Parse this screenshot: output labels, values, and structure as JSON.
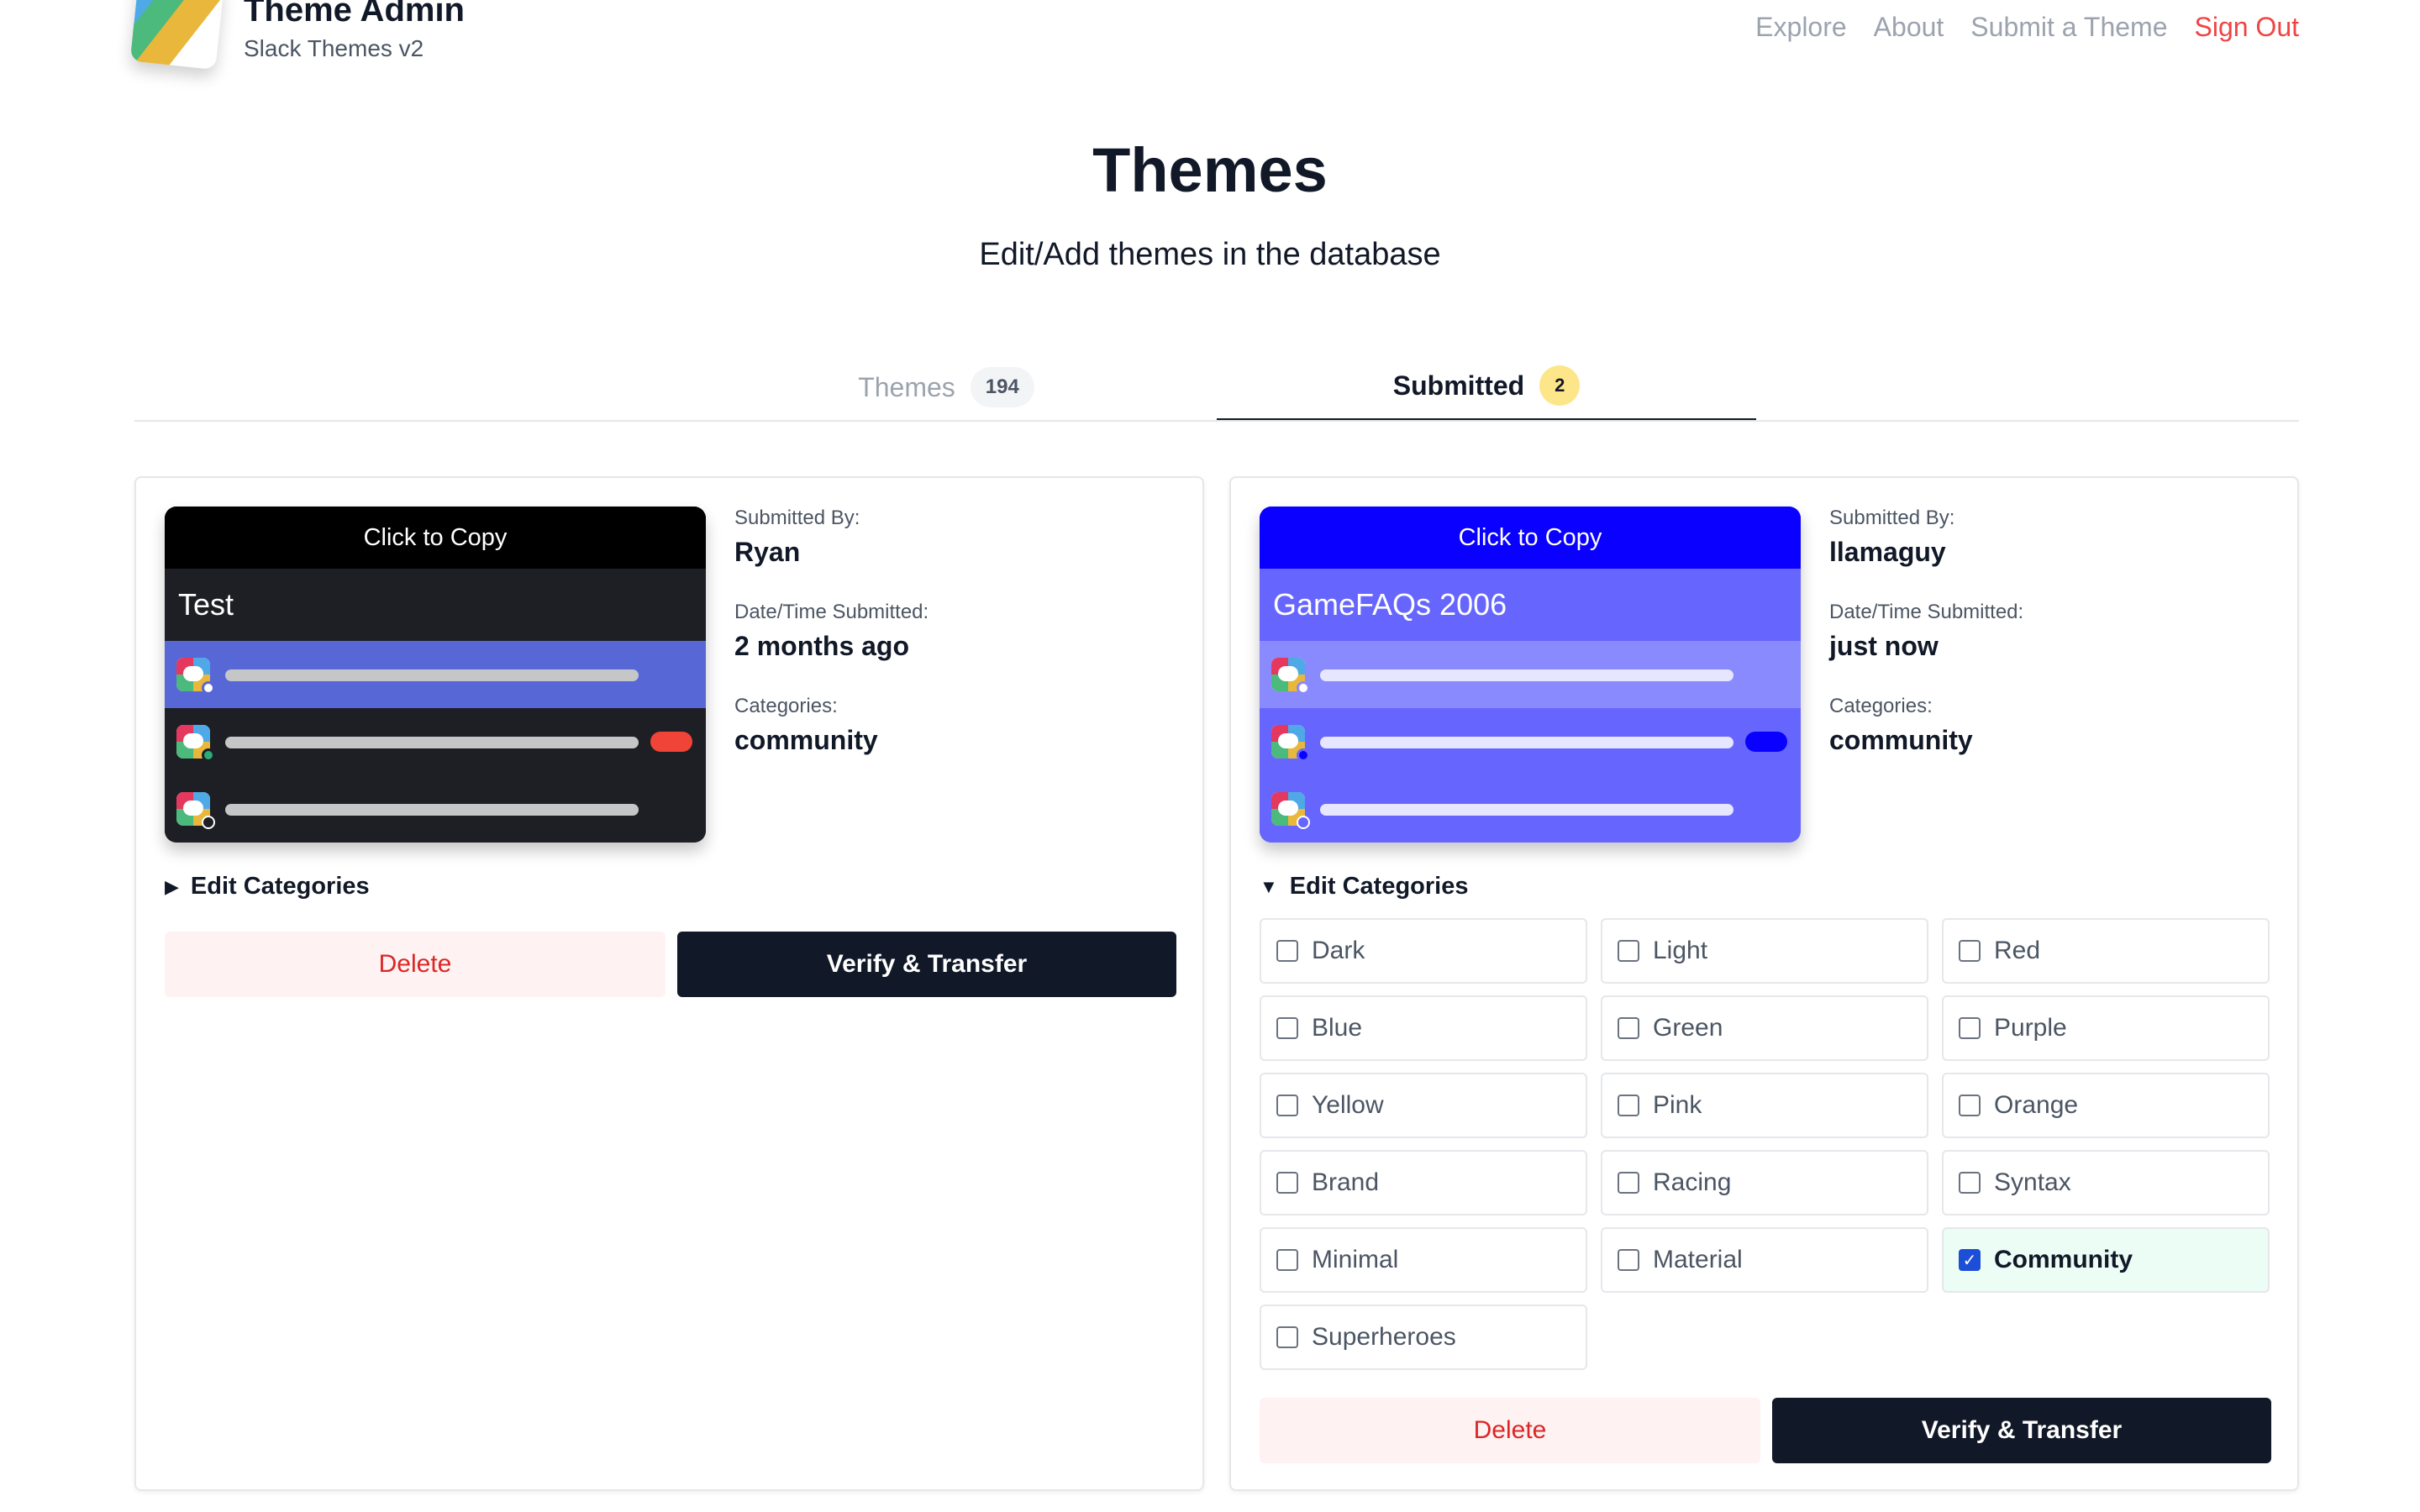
{
  "header": {
    "title": "Theme Admin",
    "subtitle": "Slack Themes v2",
    "nav": [
      "Explore",
      "About",
      "Submit a Theme"
    ],
    "sign_out": "Sign Out"
  },
  "hero": {
    "title": "Themes",
    "subtitle": "Edit/Add themes in the database"
  },
  "tabs": [
    {
      "label": "Themes",
      "count": "194",
      "active": false
    },
    {
      "label": "Submitted",
      "count": "2",
      "active": true
    }
  ],
  "labels": {
    "copy": "Click to Copy",
    "submitted_by": "Submitted By:",
    "date_time": "Date/Time Submitted:",
    "categories": "Categories:",
    "edit_categories": "Edit Categories",
    "delete": "Delete",
    "verify": "Verify & Transfer",
    "collapsed_marker": "▶",
    "expanded_marker": "▼"
  },
  "cards": [
    {
      "theme_name": "Test",
      "submitted_by": "Ryan",
      "submitted_at": "2 months ago",
      "categories": "community",
      "categories_expanded": false,
      "colors": {
        "copy_bar": "#000000",
        "sidebar": "#1e1f24",
        "active": "#5867d6",
        "bar": "#c5c6c8",
        "mention": "#f04438",
        "presence": "#2bac76"
      }
    },
    {
      "theme_name": "GameFAQs 2006",
      "submitted_by": "llamaguy",
      "submitted_at": "just now",
      "categories": "community",
      "categories_expanded": true,
      "colors": {
        "copy_bar": "#0a00ff",
        "sidebar": "#6666ff",
        "active": "#8a8aff",
        "bar": "#e6e6ff",
        "mention": "#0a00ff",
        "presence": "#0a00ff"
      },
      "category_options": [
        {
          "label": "Dark",
          "checked": false
        },
        {
          "label": "Light",
          "checked": false
        },
        {
          "label": "Red",
          "checked": false
        },
        {
          "label": "Blue",
          "checked": false
        },
        {
          "label": "Green",
          "checked": false
        },
        {
          "label": "Purple",
          "checked": false
        },
        {
          "label": "Yellow",
          "checked": false
        },
        {
          "label": "Pink",
          "checked": false
        },
        {
          "label": "Orange",
          "checked": false
        },
        {
          "label": "Brand",
          "checked": false
        },
        {
          "label": "Racing",
          "checked": false
        },
        {
          "label": "Syntax",
          "checked": false
        },
        {
          "label": "Minimal",
          "checked": false
        },
        {
          "label": "Material",
          "checked": false
        },
        {
          "label": "Community",
          "checked": true
        },
        {
          "label": "Superheroes",
          "checked": false
        }
      ]
    }
  ],
  "logo_colors": [
    "#e5385f",
    "#4ea9e6",
    "#4bba7c",
    "#e8b73c"
  ]
}
